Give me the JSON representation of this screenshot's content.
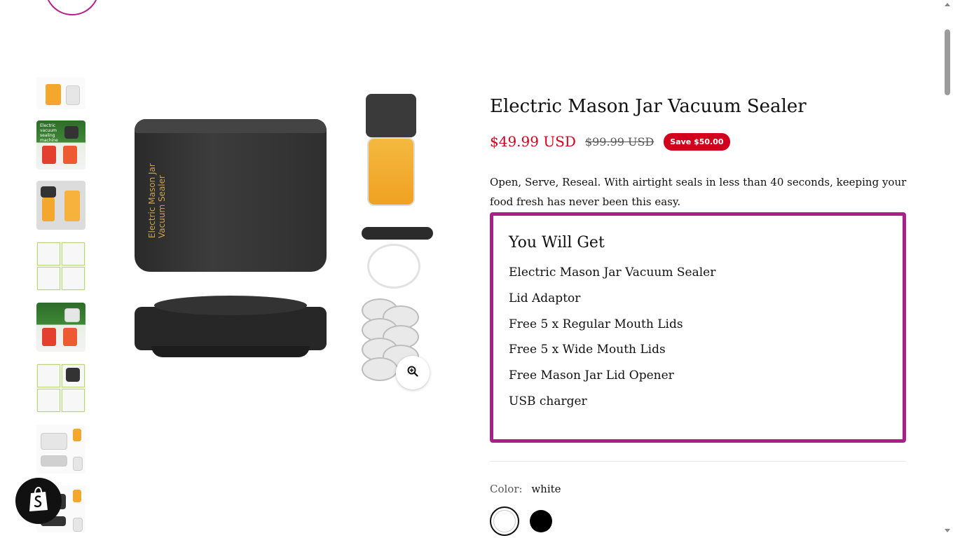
{
  "product": {
    "title": "Electric Mason Jar Vacuum Sealer",
    "price": "$49.99 USD",
    "compare_price": "$99.99 USD",
    "save_badge": "Save $50.00",
    "description": "Open, Serve, Reseal. With airtight seals in less than 40 seconds, keeping your food fresh has never been this easy.",
    "image_text": "Electric Mason Jar Vacuum Sealer"
  },
  "you_will_get": {
    "title": "You Will Get",
    "items": [
      "Electric Mason Jar Vacuum Sealer",
      "Lid Adaptor",
      "Free 5 x Regular Mouth Lids",
      "Free 5 x Wide Mouth Lids",
      "Free Mason Jar Lid Opener",
      "USB charger"
    ]
  },
  "color_option": {
    "label": "Color:",
    "selected": "white",
    "swatches": [
      "white",
      "black"
    ]
  },
  "thumbnails": {
    "count": 8,
    "green_caption": "Electric vacuum sealing machine"
  },
  "icons": {
    "zoom": "zoom-in-icon",
    "shop": "shopify-bag-icon",
    "logo": "brand-logo"
  },
  "colors": {
    "accent": "#a8218a",
    "sale": "#d1001c",
    "text": "#111111"
  }
}
